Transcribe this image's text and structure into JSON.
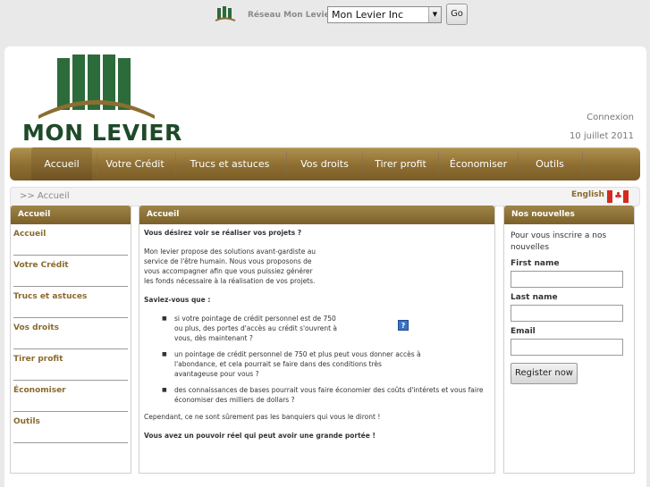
{
  "topbar": {
    "network_label": "Réseau Mon Levier",
    "selected_site": "Mon Levier Inc",
    "go_label": "Go"
  },
  "header": {
    "logo_text": "MON LEVIER",
    "connexion": "Connexion",
    "date": "10 juillet 2011"
  },
  "nav": {
    "items": [
      "Accueil",
      "Votre Crédit",
      "Trucs et astuces",
      "Vos droits",
      "Tirer profit",
      "Économiser",
      "Outils"
    ]
  },
  "breadcrumb": {
    "text": ">> Accueil",
    "language": "English"
  },
  "left": {
    "title": "Accueil",
    "links": [
      "Accueil",
      "Votre Crédit",
      "Trucs et astuces",
      "Vos droits",
      "Tirer profit",
      "Économiser",
      "Outils"
    ]
  },
  "main": {
    "title": "Accueil",
    "question": "Vous désirez voir se réaliser vos projets ?",
    "intro": "Mon levier propose des solutions avant-gardiste au service de l'être humain. Nous vous proposons de vous accompagner afin que vous puissiez générer les fonds nécessaire à la réalisation de vos projets.",
    "saviez": "Saviez-vous que :",
    "bullets": [
      "si votre pointage de crédit personnel est de 750 ou plus, des portes d'accès au crédit s'ouvrent à vous, dès maintenant ?",
      "un pointage de crédit personnel de 750 et plus peut vous donner accès à l'abondance, et cela pourrait se faire dans des conditions très avantageuse pour vous ?",
      "des connaissances de bases pourrait vous faire économier des coûts d'intérets et vous faire économiser des milliers de dollars ?"
    ],
    "help_icon_label": "?",
    "closing": "Cependant, ce ne sont sûrement pas les banquiers qui vous le diront !",
    "cut_line": "Vous avez un pouvoir réel qui peut avoir une grande portée !"
  },
  "newsletter": {
    "title": "Nos nouvelles",
    "intro": "Pour vous inscrire a nos nouvelles",
    "first_name_label": "First name",
    "last_name_label": "Last name",
    "email_label": "Email",
    "register_label": "Register now"
  },
  "colors": {
    "nav_gold": "#8d6d31",
    "link_gold": "#8a6a2c",
    "logo_green": "#1f4a2a"
  }
}
